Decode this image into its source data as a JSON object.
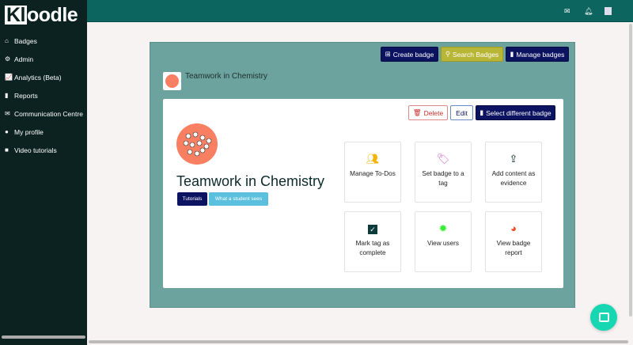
{
  "logo": "Kloodle",
  "sidebar": {
    "items": [
      {
        "label": "Badges",
        "icon": "home-icon"
      },
      {
        "label": "Admin",
        "icon": "cogs-icon"
      },
      {
        "label": "Analytics (Beta)",
        "icon": "chart-icon"
      },
      {
        "label": "Reports",
        "icon": "file-icon"
      },
      {
        "label": "Communication Centre",
        "icon": "envelope-icon"
      },
      {
        "label": "My profile",
        "icon": "user-icon"
      },
      {
        "label": "Video tutorials",
        "icon": "video-icon"
      }
    ]
  },
  "toolbar": {
    "create": "Create badge",
    "search": "Search Badges",
    "manage": "Manage badges"
  },
  "header_title": "Teamwork in Chemistry",
  "card": {
    "delete": "Delete",
    "edit": "Edit",
    "select": "Select different badge",
    "title": "Teamwork in Chemistry",
    "tutorials": "Tutorials",
    "student_view": "What a student sees"
  },
  "tiles": [
    {
      "label": "Manage To-Dos",
      "icon": "users-icon",
      "color": "#f5b400"
    },
    {
      "label": "Set badge to a tag",
      "icon": "tags-icon",
      "color": "#d968d0"
    },
    {
      "label": "Add content as evidence",
      "icon": "upload-icon",
      "color": "#0b2a2a"
    },
    {
      "label": "Mark tag as complete",
      "icon": "check-square-icon",
      "color": "#0b3b3b"
    },
    {
      "label": "View users",
      "icon": "certificate-icon",
      "color": "#33ee33"
    },
    {
      "label": "View badge report",
      "icon": "pie-chart-icon",
      "color": "#f04d23"
    }
  ],
  "colors": {
    "sidebar": "#0b2220",
    "topbar": "#0d6560",
    "panel": "#6ca39e",
    "primary": "#0c1361",
    "search": "#b8b636",
    "danger": "#c9302c",
    "info": "#5bc0de",
    "badge": "#f97f62",
    "chat": "#17d7b2"
  }
}
